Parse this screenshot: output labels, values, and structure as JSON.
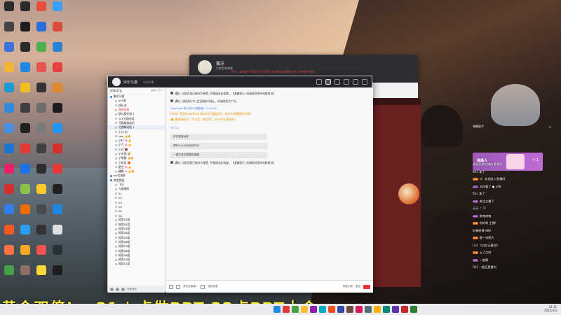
{
  "desktop_icons": [
    {
      "label": "",
      "color": "#2b2b2b",
      "col": 0,
      "row": 0
    },
    {
      "label": "",
      "color": "#2b2b2b",
      "col": 1,
      "row": 0
    },
    {
      "label": "",
      "color": "#e94e3d",
      "col": 2,
      "row": 0
    },
    {
      "label": "",
      "color": "#3aa0ff",
      "col": 3,
      "row": 0
    },
    {
      "label": "",
      "color": "#444",
      "col": 0,
      "row": 1
    },
    {
      "label": "",
      "color": "#1d1d1d",
      "col": 1,
      "row": 1
    },
    {
      "label": "",
      "color": "#2b6fd6",
      "col": 2,
      "row": 1
    },
    {
      "label": "",
      "color": "#d94c3b",
      "col": 3,
      "row": 1
    },
    {
      "label": "",
      "color": "#3c74d8",
      "col": 0,
      "row": 2
    },
    {
      "label": "",
      "color": "#2a2a2a",
      "col": 1,
      "row": 2
    },
    {
      "label": "",
      "color": "#4caf50",
      "col": 2,
      "row": 2
    },
    {
      "label": "",
      "color": "#2a82d6",
      "col": 3,
      "row": 2
    },
    {
      "label": "",
      "color": "#f2b632",
      "col": 0,
      "row": 3
    },
    {
      "label": "",
      "color": "#1e88e5",
      "col": 1,
      "row": 3
    },
    {
      "label": "",
      "color": "#e3554d",
      "col": 2,
      "row": 3
    },
    {
      "label": "",
      "color": "#e84040",
      "col": 3,
      "row": 3
    },
    {
      "label": "",
      "color": "#1b9bd1",
      "col": 0,
      "row": 4
    },
    {
      "label": "",
      "color": "#f0c020",
      "col": 1,
      "row": 4
    },
    {
      "label": "",
      "color": "#333",
      "col": 2,
      "row": 4
    },
    {
      "label": "",
      "color": "#e0882e",
      "col": 3,
      "row": 4
    },
    {
      "label": "",
      "color": "#2f8be0",
      "col": 0,
      "row": 5
    },
    {
      "label": "",
      "color": "#3f3f3f",
      "col": 1,
      "row": 5
    },
    {
      "label": "",
      "color": "#6d6d6d",
      "col": 2,
      "row": 5
    },
    {
      "label": "",
      "color": "#1c1c1c",
      "col": 3,
      "row": 5
    },
    {
      "label": "",
      "color": "#4a90e2",
      "col": 0,
      "row": 6
    },
    {
      "label": "",
      "color": "#212121",
      "col": 1,
      "row": 6
    },
    {
      "label": "",
      "color": "#7a7a7a",
      "col": 2,
      "row": 6
    },
    {
      "label": "",
      "color": "#2196f3",
      "col": 3,
      "row": 6
    },
    {
      "label": "",
      "color": "#1976d2",
      "col": 0,
      "row": 7
    },
    {
      "label": "",
      "color": "#e53935",
      "col": 1,
      "row": 7
    },
    {
      "label": "",
      "color": "#404040",
      "col": 2,
      "row": 7
    },
    {
      "label": "",
      "color": "#d32f2f",
      "col": 3,
      "row": 7
    },
    {
      "label": "",
      "color": "#e91e63",
      "col": 0,
      "row": 8
    },
    {
      "label": "",
      "color": "#1a73e8",
      "col": 1,
      "row": 8
    },
    {
      "label": "",
      "color": "#2d2d2d",
      "col": 2,
      "row": 8
    },
    {
      "label": "",
      "color": "#e53935",
      "col": 3,
      "row": 8
    },
    {
      "label": "",
      "color": "#d32f2f",
      "col": 0,
      "row": 9
    },
    {
      "label": "",
      "color": "#8bc34a",
      "col": 1,
      "row": 9
    },
    {
      "label": "",
      "color": "#ffca28",
      "col": 2,
      "row": 9
    },
    {
      "label": "",
      "color": "#212121",
      "col": 3,
      "row": 9
    },
    {
      "label": "",
      "color": "#2f80ed",
      "col": 0,
      "row": 10
    },
    {
      "label": "",
      "color": "#ef6c00",
      "col": 1,
      "row": 10
    },
    {
      "label": "",
      "color": "#4a4a4a",
      "col": 2,
      "row": 10
    },
    {
      "label": "",
      "color": "#1e88e5",
      "col": 3,
      "row": 10
    },
    {
      "label": "",
      "color": "#ff5722",
      "col": 0,
      "row": 11
    },
    {
      "label": "",
      "color": "#2a9df4",
      "col": 1,
      "row": 11
    },
    {
      "label": "",
      "color": "#333333",
      "col": 2,
      "row": 11
    },
    {
      "label": "",
      "color": "#e0e0e0",
      "col": 3,
      "row": 11
    },
    {
      "label": "",
      "color": "#ff7043",
      "col": 0,
      "row": 12
    },
    {
      "label": "",
      "color": "#f9a825",
      "col": 1,
      "row": 12
    },
    {
      "label": "",
      "color": "#ef5350",
      "col": 2,
      "row": 12
    },
    {
      "label": "",
      "color": "#263238",
      "col": 3,
      "row": 12
    },
    {
      "label": "",
      "color": "#43a047",
      "col": 0,
      "row": 13
    },
    {
      "label": "",
      "color": "#8d6e63",
      "col": 1,
      "row": 13
    },
    {
      "label": "",
      "color": "#fdd835",
      "col": 2,
      "row": 13
    },
    {
      "label": "",
      "color": "#1e1e1e",
      "col": 3,
      "row": 13
    }
  ],
  "back_window": {
    "name": "雅洋",
    "subtitle": "大都是哪哪哪",
    "notice": "警告 · ▶新客户获得 [会员资格] 每次腾讯面最新信息, 仅供参考使用"
  },
  "main_window": {
    "title": "快乐马猫",
    "count": "241456",
    "left_header": "群聊/好友",
    "left_header_right": "高级人员 ▾",
    "contacts": [
      {
        "label": "聚名马猫",
        "type": "group"
      },
      {
        "label": "pt+群",
        "type": "child"
      },
      {
        "label": "快乐派",
        "type": "child"
      },
      {
        "label": "我的总群",
        "type": "child red"
      },
      {
        "label": "群与群交流 1",
        "type": "child"
      },
      {
        "label": "TCP大咖分组",
        "type": "child"
      },
      {
        "label": "马猫群组成员",
        "type": "child"
      },
      {
        "label": "左图精选组 1",
        "type": "child selected"
      },
      {
        "label": "小马 🐱",
        "type": "child"
      },
      {
        "label": "talu 👍🔥",
        "type": "child"
      },
      {
        "label": "小红 🌸👍",
        "type": "child"
      },
      {
        "label": "小兰 🌸👍",
        "type": "child"
      },
      {
        "label": "小凡 🐻",
        "type": "child"
      },
      {
        "label": "小天使 🌈",
        "type": "child"
      },
      {
        "label": "小熊猫 👍🔥",
        "type": "child"
      },
      {
        "label": "小吃货 🎁",
        "type": "child"
      },
      {
        "label": "星空 🌸👍",
        "type": "child"
      },
      {
        "label": "糖果 🍬👍🔥",
        "type": "child"
      },
      {
        "label": "we交流群",
        "type": "group"
      },
      {
        "label": "常用群组",
        "type": "group"
      },
      {
        "label": "飞马",
        "type": "child"
      },
      {
        "label": "九尾猫咪",
        "type": "child"
      },
      {
        "label": "01",
        "type": "child"
      },
      {
        "label": "02",
        "type": "child"
      },
      {
        "label": "03",
        "type": "child"
      },
      {
        "label": "04",
        "type": "child"
      },
      {
        "label": "05",
        "type": "child"
      },
      {
        "label": "06",
        "type": "child"
      },
      {
        "label": "轮用01组",
        "type": "child"
      },
      {
        "label": "轮用02组",
        "type": "child"
      },
      {
        "label": "轮用03组",
        "type": "child"
      },
      {
        "label": "轮用04组",
        "type": "child"
      },
      {
        "label": "轮用05组",
        "type": "child"
      },
      {
        "label": "轮用06组",
        "type": "child"
      },
      {
        "label": "轮用07组",
        "type": "child"
      },
      {
        "label": "轮用08组",
        "type": "child"
      },
      {
        "label": "轮用09组",
        "type": "child"
      },
      {
        "label": "轮用10组",
        "type": "child"
      },
      {
        "label": "轮用11组",
        "type": "child"
      }
    ],
    "left_footer": "四处漂泊",
    "chat": {
      "notice1": "通知: 当前页面已被对方接受, 仔细请务必核查。【温馨提示: 同请给您发布电影地址】",
      "notice2": "通知: 当前进行中 [会员服务升级] 。同请给您点个好。",
      "hello_name": "DeepSeek 群 (快乐马猫群组) 13:24:42",
      "hello1": "Hello! 我是DeepSeek 群(快乐马猫群组)，有任何问题随时在群！",
      "hello2": "🙂 需要咱的好，写文案，聊日常，24小时在线陪伴！",
      "section": "你可以:",
      "pills": [
        "讲讲星座运势",
        "帮你从头分析如何写作",
        "一键生成你想要的美图"
      ],
      "notice3": "通知: 当前页面已被对方接受, 仔细请务必核查。【温馨提示: 同请给您发布电影地址】"
    },
    "toolbar": {
      "input_hint": "请在这里输...",
      "left_label": "语言信息",
      "right_a": "发送",
      "right_b": "消息记录"
    }
  },
  "live_panel": {
    "header": "弹幕助手",
    "gift_name": "我是人",
    "gift_count": "× 1",
    "messages": [
      {
        "badge": "",
        "user": "",
        "text": "欢迎光临主播的直播间"
      },
      {
        "badge": "",
        "user": "",
        "text": "ftxc 来了"
      },
      {
        "badge": "LV5",
        "user": "冰·",
        "text": "欢迎进入直播间"
      },
      {
        "badge": "LV3",
        "user": "",
        "text": "太好看了 ● x58"
      },
      {
        "badge": "",
        "user": "",
        "text": "ftxc 来了"
      },
      {
        "badge": "LV9",
        "user": "",
        "text": "关注主播了"
      },
      {
        "badge": "",
        "user": "",
        "text": "天天 ♡ 7:"
      },
      {
        "badge": "LV4",
        "user": "",
        "text": "来咯来咯"
      },
      {
        "badge": "LV2",
        "user": "",
        "text": "你好呀 主播!"
      },
      {
        "badge": "",
        "user": "",
        "text": "好棒好棒 666"
      },
      {
        "badge": "LV6",
        "user": "",
        "text": "要一张图片"
      },
      {
        "badge": "",
        "user": "",
        "text": "[小] 《对自己看好》"
      },
      {
        "badge": "LV8",
        "user": "",
        "text": "上了点的"
      },
      {
        "badge": "LV2",
        "user": "",
        "text": "一般啊"
      },
      {
        "badge": "",
        "user": "",
        "text": "[年] 一般还是要吗"
      }
    ]
  },
  "banner": {
    "text": "黄金双倍! 一21 | 点做PPT 22点PPT大会"
  },
  "taskbar": {
    "time": "22:11",
    "date": "2025/3/3",
    "icons": [
      "#1e88e5",
      "#e53935",
      "#43a047",
      "#fbc02d",
      "#8e24aa",
      "#00acc1",
      "#f4511e",
      "#3949ab",
      "#6d4c41",
      "#d81b60",
      "#546e7a",
      "#ffb300",
      "#00897b",
      "#5e35b1",
      "#c62828",
      "#2e7d32"
    ]
  }
}
